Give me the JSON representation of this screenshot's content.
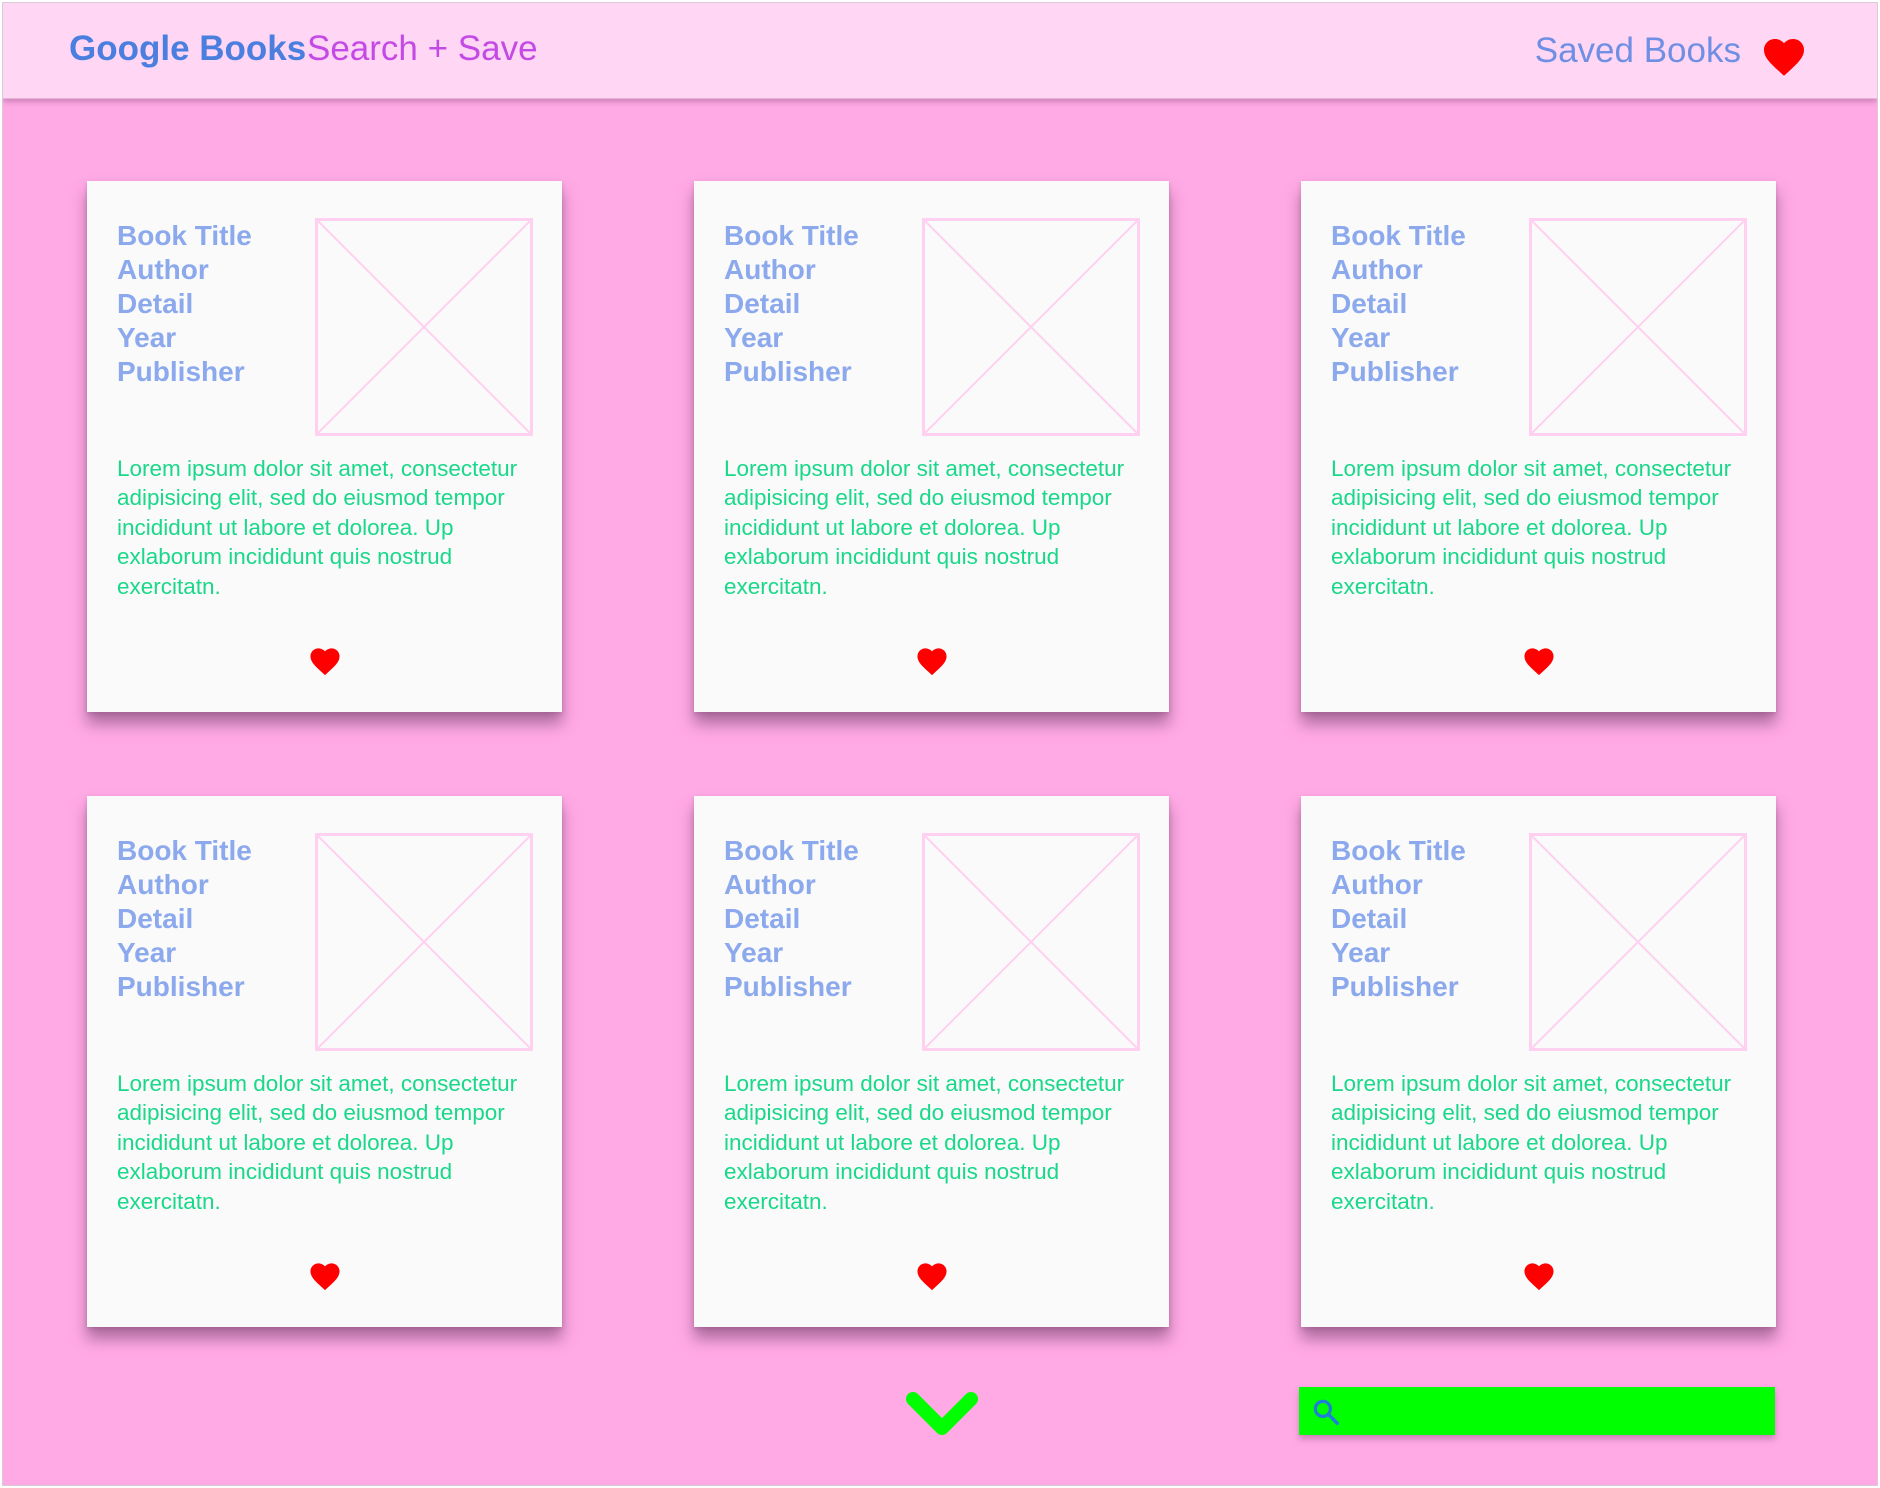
{
  "header": {
    "brand": "Google Books",
    "tagline": "Search + Save",
    "saved_books_label": "Saved Books",
    "saved_icon": "heart-icon"
  },
  "colors": {
    "background": "#ffa9e5",
    "header_background": "#ffd6f3",
    "brand": "#4a7fe0",
    "tagline": "#c44ae6",
    "saved_link": "#6f8fe4",
    "card_meta": "#8ba9ec",
    "card_description": "#19d889",
    "heart": "#ff0000",
    "chevron": "#00ff00",
    "search_bar": "#00ff00",
    "thumbnail_placeholder": "#ffd0ef"
  },
  "cards": [
    {
      "title": "Book Title",
      "author": "Author",
      "detail": "Detail",
      "year": "Year",
      "publisher": "Publisher",
      "description": "Lorem ipsum dolor sit amet, consectetur adipisicing elit, sed do eiusmod tempor incididunt ut labore et dolorea. Up exlaborum incididunt quis nostrud exercitatn.",
      "thumbnail": "image-placeholder",
      "favorite_icon": "heart-icon"
    },
    {
      "title": "Book Title",
      "author": "Author",
      "detail": "Detail",
      "year": "Year",
      "publisher": "Publisher",
      "description": "Lorem ipsum dolor sit amet, consectetur adipisicing elit, sed do eiusmod tempor incididunt ut labore et dolorea. Up exlaborum incididunt quis nostrud exercitatn.",
      "thumbnail": "image-placeholder",
      "favorite_icon": "heart-icon"
    },
    {
      "title": "Book Title",
      "author": "Author",
      "detail": "Detail",
      "year": "Year",
      "publisher": "Publisher",
      "description": "Lorem ipsum dolor sit amet, consectetur adipisicing elit, sed do eiusmod tempor incididunt ut labore et dolorea. Up exlaborum incididunt quis nostrud exercitatn.",
      "thumbnail": "image-placeholder",
      "favorite_icon": "heart-icon"
    },
    {
      "title": "Book Title",
      "author": "Author",
      "detail": "Detail",
      "year": "Year",
      "publisher": "Publisher",
      "description": "Lorem ipsum dolor sit amet, consectetur adipisicing elit, sed do eiusmod tempor incididunt ut labore et dolorea. Up exlaborum incididunt quis nostrud exercitatn.",
      "thumbnail": "image-placeholder",
      "favorite_icon": "heart-icon"
    },
    {
      "title": "Book Title",
      "author": "Author",
      "detail": "Detail",
      "year": "Year",
      "publisher": "Publisher",
      "description": "Lorem ipsum dolor sit amet, consectetur adipisicing elit, sed do eiusmod tempor incididunt ut labore et dolorea. Up exlaborum incididunt quis nostrud exercitatn.",
      "thumbnail": "image-placeholder",
      "favorite_icon": "heart-icon"
    },
    {
      "title": "Book Title",
      "author": "Author",
      "detail": "Detail",
      "year": "Year",
      "publisher": "Publisher",
      "description": "Lorem ipsum dolor sit amet, consectetur adipisicing elit, sed do eiusmod tempor incididunt ut labore et dolorea. Up exlaborum incididunt quis nostrud exercitatn.",
      "thumbnail": "image-placeholder",
      "favorite_icon": "heart-icon"
    }
  ],
  "footer": {
    "more_icon": "chevron-down-icon",
    "search": {
      "icon": "search-icon",
      "value": "",
      "placeholder": ""
    }
  }
}
